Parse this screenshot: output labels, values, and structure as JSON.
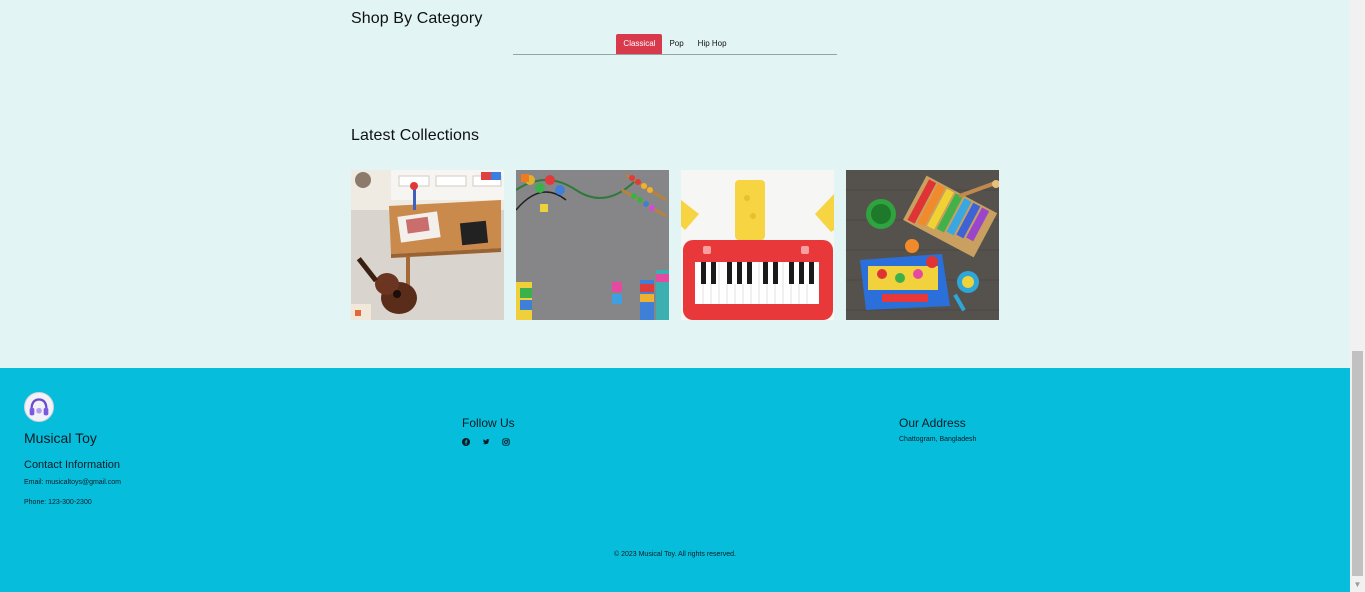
{
  "shop": {
    "title": "Shop By Category",
    "tabs": [
      {
        "label": "Classical",
        "active": true
      },
      {
        "label": "Pop",
        "active": false
      },
      {
        "label": "Hip Hop",
        "active": false
      }
    ]
  },
  "latest": {
    "title": "Latest Collections",
    "images": [
      "ukulele-playroom-image",
      "toy-abacus-carpet-image",
      "toy-piano-image",
      "toy-instruments-xylophone-image"
    ]
  },
  "footer": {
    "brand": "Musical Toy",
    "contact_title": "Contact Information",
    "email": "Email: musicaltoys@gmail.com",
    "phone": "Phone: 123-300-2300",
    "follow_title": "Follow Us",
    "social_icons": [
      "facebook-icon",
      "twitter-icon",
      "instagram-icon"
    ],
    "address_title": "Our Address",
    "address": "Chattogram, Bangladesh",
    "copyright": "© 2023 Musical Toy. All rights reserved."
  },
  "colors": {
    "background": "#e2f4f4",
    "accent": "#d83a4c",
    "footer": "#06bedc"
  }
}
